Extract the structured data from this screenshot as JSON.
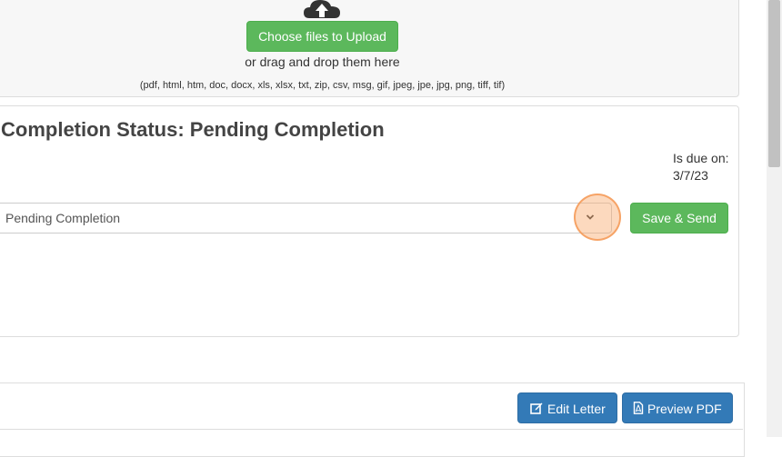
{
  "upload": {
    "button_label": "Choose files to Upload",
    "drag_text": "or drag and drop them here",
    "file_types": "(pdf, html, htm, doc, docx, xls, xlsx, txt, zip, csv, msg, gif, jpeg, jpe, jpg, png, tiff, tif)",
    "icon": "cloud-upload-icon"
  },
  "status": {
    "title": "Completion Status: Pending Completion",
    "due_label": "Is due on:",
    "due_date": "3/7/23",
    "select_value": "Pending Completion",
    "save_label": "Save & Send"
  },
  "letter": {
    "edit_label": "Edit Letter",
    "preview_label": "Preview PDF",
    "edit_icon": "edit-icon",
    "preview_icon": "pdf-file-icon"
  },
  "colors": {
    "success": "#5cb85c",
    "primary": "#337ab7",
    "click_marker": "#f8aa6e"
  }
}
